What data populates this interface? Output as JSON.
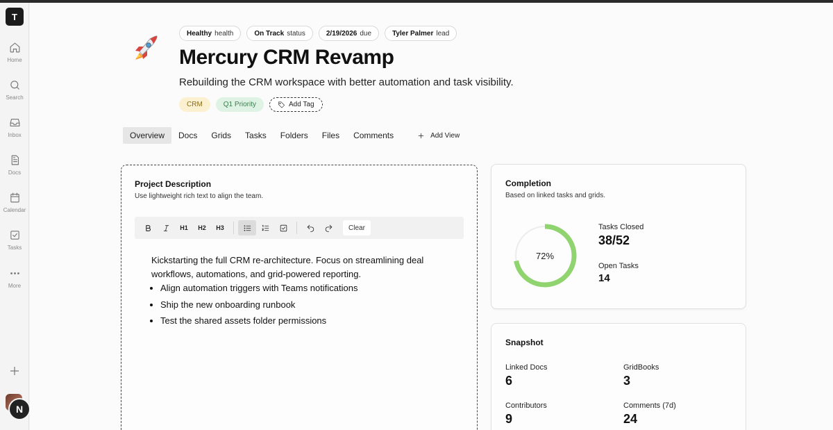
{
  "sidebar": {
    "workspace_initial": "T",
    "items": [
      {
        "label": "Home",
        "icon": "home-icon"
      },
      {
        "label": "Search",
        "icon": "search-icon"
      },
      {
        "label": "Inbox",
        "icon": "inbox-icon"
      },
      {
        "label": "Docs",
        "icon": "doc-icon"
      },
      {
        "label": "Calendar",
        "icon": "calendar-icon"
      },
      {
        "label": "Tasks",
        "icon": "checkbox-icon"
      },
      {
        "label": "More",
        "icon": "more-dots-icon"
      }
    ],
    "add_icon": "plus-icon",
    "avatar_initial": "N"
  },
  "project": {
    "emoji": "rocket",
    "pills": [
      {
        "value": "Healthy",
        "suffix": "health"
      },
      {
        "value": "On Track",
        "suffix": "status"
      },
      {
        "value": "2/19/2026",
        "suffix": "due"
      },
      {
        "value": "Tyler Palmer",
        "suffix": "lead"
      }
    ],
    "title": "Mercury CRM Revamp",
    "subtitle": "Rebuilding the CRM workspace with better automation and task visibility.",
    "tags": [
      "CRM",
      "Q1 Priority"
    ],
    "add_tag_label": "Add Tag"
  },
  "tabs": {
    "items": [
      "Overview",
      "Docs",
      "Grids",
      "Tasks",
      "Folders",
      "Files",
      "Comments"
    ],
    "active": "Overview",
    "add_view_label": "Add View"
  },
  "description": {
    "title": "Project Description",
    "subtitle": "Use lightweight rich text to align the team.",
    "toolbar": {
      "heading_labels": [
        "H1",
        "H2",
        "H3"
      ],
      "clear_label": "Clear"
    },
    "body": "Kickstarting the full CRM re-architecture. Focus on streamlining deal workflows, automations, and grid-powered reporting.",
    "bullets": [
      "Align automation triggers with Teams notifications",
      "Ship the new onboarding runbook",
      "Test the shared assets folder permissions"
    ]
  },
  "completion": {
    "title": "Completion",
    "subtitle": "Based on linked tasks and grids.",
    "percent_label": "72%",
    "percent": 0.72,
    "ring_color": "#8fd46e",
    "tasks_closed_label": "Tasks Closed",
    "tasks_closed_value": "38/52",
    "open_tasks_label": "Open Tasks",
    "open_tasks_value": "14"
  },
  "snapshot": {
    "title": "Snapshot",
    "stats": [
      {
        "label": "Linked Docs",
        "value": "6"
      },
      {
        "label": "GridBooks",
        "value": "3"
      },
      {
        "label": "Contributors",
        "value": "9"
      },
      {
        "label": "Comments (7d)",
        "value": "24"
      }
    ]
  }
}
